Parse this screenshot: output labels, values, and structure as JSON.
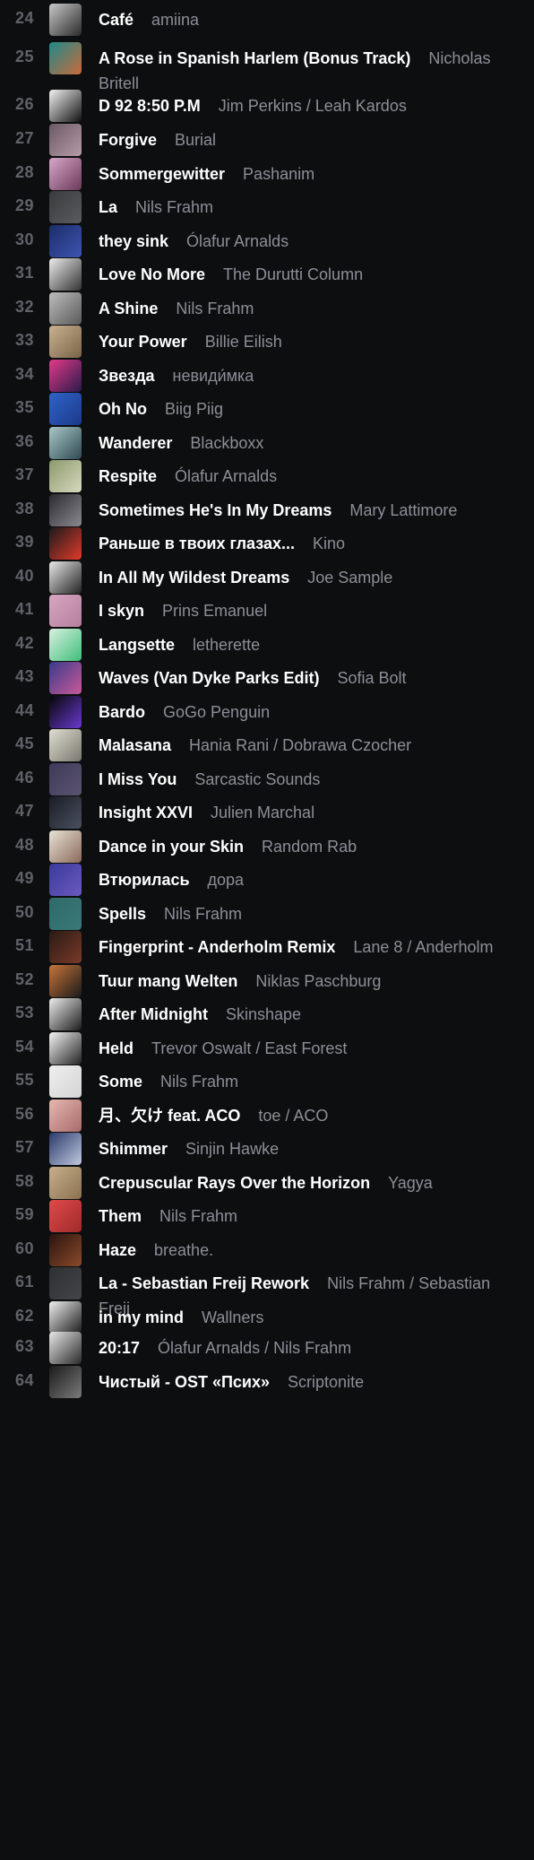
{
  "tracks": [
    {
      "num": "24",
      "title": "Café",
      "artist": "amiina",
      "art": [
        "#c9c9c9",
        "#2a2a2a"
      ]
    },
    {
      "num": "25",
      "title": "A Rose in Spanish Harlem (Bonus Track)",
      "artist": "Nicholas Britell",
      "art": [
        "#1f8a8a",
        "#c96a3a"
      ]
    },
    {
      "num": "26",
      "title": "D 92 8:50 P.M",
      "artist": "Jim Perkins / Leah Kardos",
      "art": [
        "#f2f2f2",
        "#111111"
      ]
    },
    {
      "num": "27",
      "title": "Forgive",
      "artist": "Burial",
      "art": [
        "#6a5a66",
        "#b79aa6"
      ]
    },
    {
      "num": "28",
      "title": "Sommergewitter",
      "artist": "Pashanim",
      "art": [
        "#d7a6c9",
        "#6b3a5a"
      ]
    },
    {
      "num": "29",
      "title": "La",
      "artist": "Nils Frahm",
      "art": [
        "#3a3b3d",
        "#5a5b5e"
      ]
    },
    {
      "num": "30",
      "title": "they sink",
      "artist": "Ólafur Arnalds",
      "art": [
        "#1c2c6a",
        "#3e55b0"
      ]
    },
    {
      "num": "31",
      "title": "Love No More",
      "artist": "The Durutti Column",
      "art": [
        "#ececec",
        "#333333"
      ]
    },
    {
      "num": "32",
      "title": "A Shine",
      "artist": "Nils Frahm",
      "art": [
        "#bdbdbd",
        "#5a5a5a"
      ]
    },
    {
      "num": "33",
      "title": "Your Power",
      "artist": "Billie Eilish",
      "art": [
        "#c8b28f",
        "#7a6448"
      ]
    },
    {
      "num": "34",
      "title": "Звезда",
      "artist": "невиди́мка",
      "art": [
        "#e23a8a",
        "#2b1a4a"
      ]
    },
    {
      "num": "35",
      "title": "Oh No",
      "artist": "Biig Piig",
      "art": [
        "#2f63c7",
        "#1b3a8a"
      ]
    },
    {
      "num": "36",
      "title": "Wanderer",
      "artist": "Blackboxx",
      "art": [
        "#a8c7c7",
        "#2f4a52"
      ]
    },
    {
      "num": "37",
      "title": "Respite",
      "artist": "Ólafur Arnalds",
      "art": [
        "#8a9a6a",
        "#d8d8c0"
      ]
    },
    {
      "num": "38",
      "title": "Sometimes He's In My Dreams",
      "artist": "Mary Lattimore",
      "art": [
        "#2a2a30",
        "#8a8a90"
      ]
    },
    {
      "num": "39",
      "title": "Раньше в твоих глазах...",
      "artist": "Kino",
      "art": [
        "#1a1a1a",
        "#e03a2a"
      ]
    },
    {
      "num": "40",
      "title": "In All My Wildest Dreams",
      "artist": "Joe Sample",
      "art": [
        "#e8e8e8",
        "#222222"
      ]
    },
    {
      "num": "41",
      "title": "I skyn",
      "artist": "Prins Emanuel",
      "art": [
        "#d9a6c2",
        "#b37f9c"
      ]
    },
    {
      "num": "42",
      "title": "Langsette",
      "artist": "letherette",
      "art": [
        "#d9f0e0",
        "#3fbf7a"
      ]
    },
    {
      "num": "43",
      "title": "Waves (Van Dyke Parks Edit)",
      "artist": "Sofia Bolt",
      "art": [
        "#3a3a8a",
        "#c85a9a"
      ]
    },
    {
      "num": "44",
      "title": "Bardo",
      "artist": "GoGo Penguin",
      "art": [
        "#050505",
        "#6a3ad0"
      ]
    },
    {
      "num": "45",
      "title": "Malasana",
      "artist": "Hania Rani / Dobrawa Czocher",
      "art": [
        "#e0ddd2",
        "#7a776e"
      ]
    },
    {
      "num": "46",
      "title": "I Miss You",
      "artist": "Sarcastic Sounds",
      "art": [
        "#3f3a5a",
        "#5a5470"
      ]
    },
    {
      "num": "47",
      "title": "Insight XXVI",
      "artist": "Julien Marchal",
      "art": [
        "#1a1d24",
        "#4a5060"
      ]
    },
    {
      "num": "48",
      "title": "Dance in your Skin",
      "artist": "Random Rab",
      "art": [
        "#e8e2d6",
        "#8a6a5a"
      ]
    },
    {
      "num": "49",
      "title": "Втюрилась",
      "artist": "дора",
      "art": [
        "#3a3a9a",
        "#6a5ac0"
      ]
    },
    {
      "num": "50",
      "title": "Spells",
      "artist": "Nils Frahm",
      "art": [
        "#2f6a6a",
        "#3a7878"
      ]
    },
    {
      "num": "51",
      "title": "Fingerprint - Anderholm Remix",
      "artist": "Lane 8 / Anderholm",
      "art": [
        "#2a1a14",
        "#7a3a2a"
      ]
    },
    {
      "num": "52",
      "title": "Tuur mang Welten",
      "artist": "Niklas Paschburg",
      "art": [
        "#c8743a",
        "#1a1a1a"
      ]
    },
    {
      "num": "53",
      "title": "After Midnight",
      "artist": "Skinshape",
      "art": [
        "#ededed",
        "#1c1c1c"
      ]
    },
    {
      "num": "54",
      "title": "Held",
      "artist": "Trevor Oswalt / East Forest",
      "art": [
        "#f5f5f5",
        "#222222"
      ]
    },
    {
      "num": "55",
      "title": "Some",
      "artist": "Nils Frahm",
      "art": [
        "#efefef",
        "#d4d4d4"
      ]
    },
    {
      "num": "56",
      "title": "月、欠け feat. ACO",
      "artist": "toe / ACO",
      "art": [
        "#e6b8b0",
        "#a86a6a"
      ]
    },
    {
      "num": "57",
      "title": "Shimmer",
      "artist": "Sinjin Hawke",
      "art": [
        "#2a3a6a",
        "#c0c8e0"
      ]
    },
    {
      "num": "58",
      "title": "Crepuscular Rays Over the Horizon",
      "artist": "Yagya",
      "art": [
        "#c8b08a",
        "#8a7050"
      ]
    },
    {
      "num": "59",
      "title": "Them",
      "artist": "Nils Frahm",
      "art": [
        "#e04a4a",
        "#a02a2a"
      ]
    },
    {
      "num": "60",
      "title": "Haze",
      "artist": "breathe.",
      "art": [
        "#2a1410",
        "#8a4a2a"
      ]
    },
    {
      "num": "61",
      "title": "La - Sebastian Freij Rework",
      "artist": "Nils Frahm / Sebastian Freij",
      "art": [
        "#2e2f31",
        "#444548"
      ]
    },
    {
      "num": "62",
      "title": "in my mind",
      "artist": "Wallners",
      "art": [
        "#f0f0f0",
        "#1a1a1a"
      ]
    },
    {
      "num": "63",
      "title": "20:17",
      "artist": "Ólafur Arnalds / Nils Frahm",
      "art": [
        "#e8e8e8",
        "#2a2a2a"
      ]
    },
    {
      "num": "64",
      "title": "Чистый - OST «Псих»",
      "artist": "Scriptonite",
      "art": [
        "#1a1a1a",
        "#7a7a7a"
      ]
    }
  ]
}
